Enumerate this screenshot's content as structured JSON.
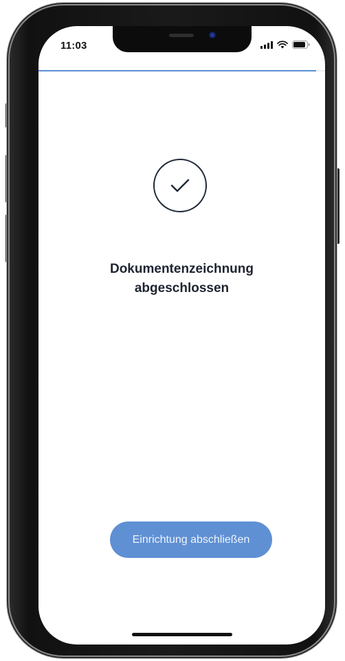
{
  "status_bar": {
    "time": "11:03",
    "icons": [
      "signal-icon",
      "wifi-icon",
      "battery-icon"
    ]
  },
  "progress": {
    "value": 0.97,
    "color": "#5b8fd6"
  },
  "main": {
    "icon": "check-circle-icon",
    "title_line1": "Dokumentenzeichnung",
    "title_line2": "abgeschlossen"
  },
  "actions": {
    "finish_label": "Einrichtung abschließen",
    "button_color": "#5f90d4"
  }
}
